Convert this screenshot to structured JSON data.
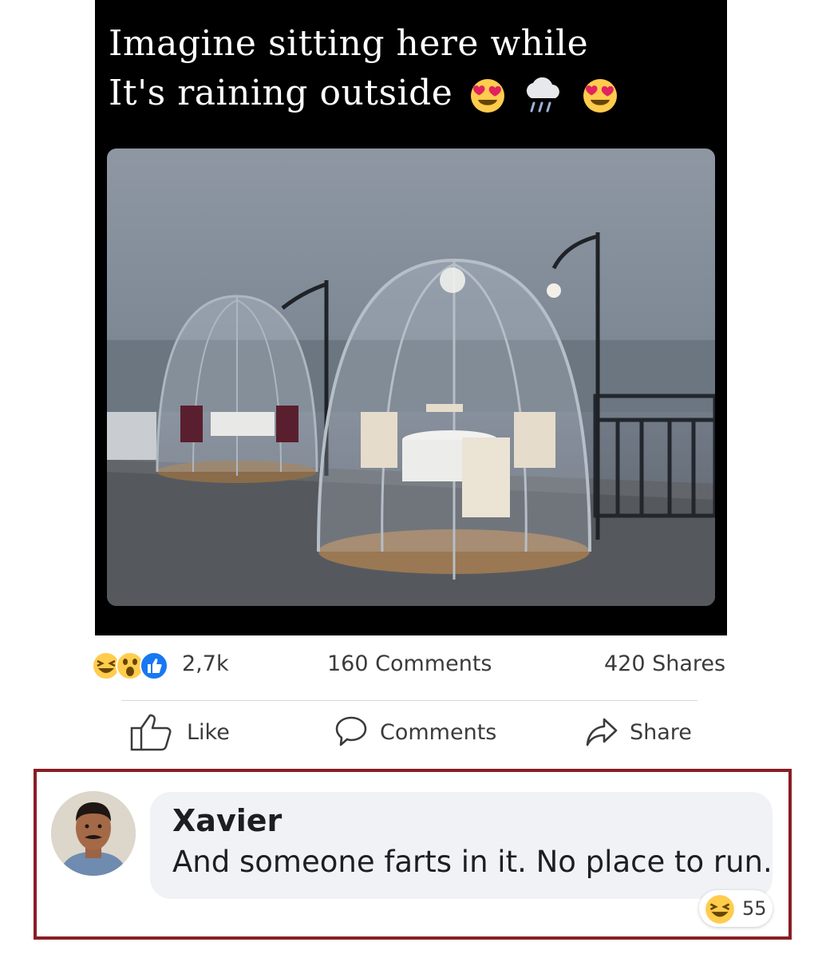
{
  "post": {
    "caption_line1": "Imagine sitting here while",
    "caption_line2": "It's raining outside",
    "caption_emojis": [
      "heart-eyes-emoji",
      "rain-cloud-emoji",
      "heart-eyes-emoji"
    ]
  },
  "stats": {
    "reactions_count": "2,7k",
    "reaction_icons": [
      "laughing-icon",
      "wow-icon",
      "like-icon"
    ],
    "comments": "160 Comments",
    "shares": "420 Shares"
  },
  "actions": {
    "like": "Like",
    "comments": "Comments",
    "share": "Share"
  },
  "comment": {
    "author": "Xavier",
    "text": "And someone farts in it. No place to run.",
    "reaction_icon": "laughing-icon",
    "reaction_count": "55"
  },
  "colors": {
    "highlight_border": "#8a1d24",
    "like_blue": "#1877f2",
    "emoji_yellow": "#ffcc4d",
    "heart_red": "#e0245e"
  }
}
